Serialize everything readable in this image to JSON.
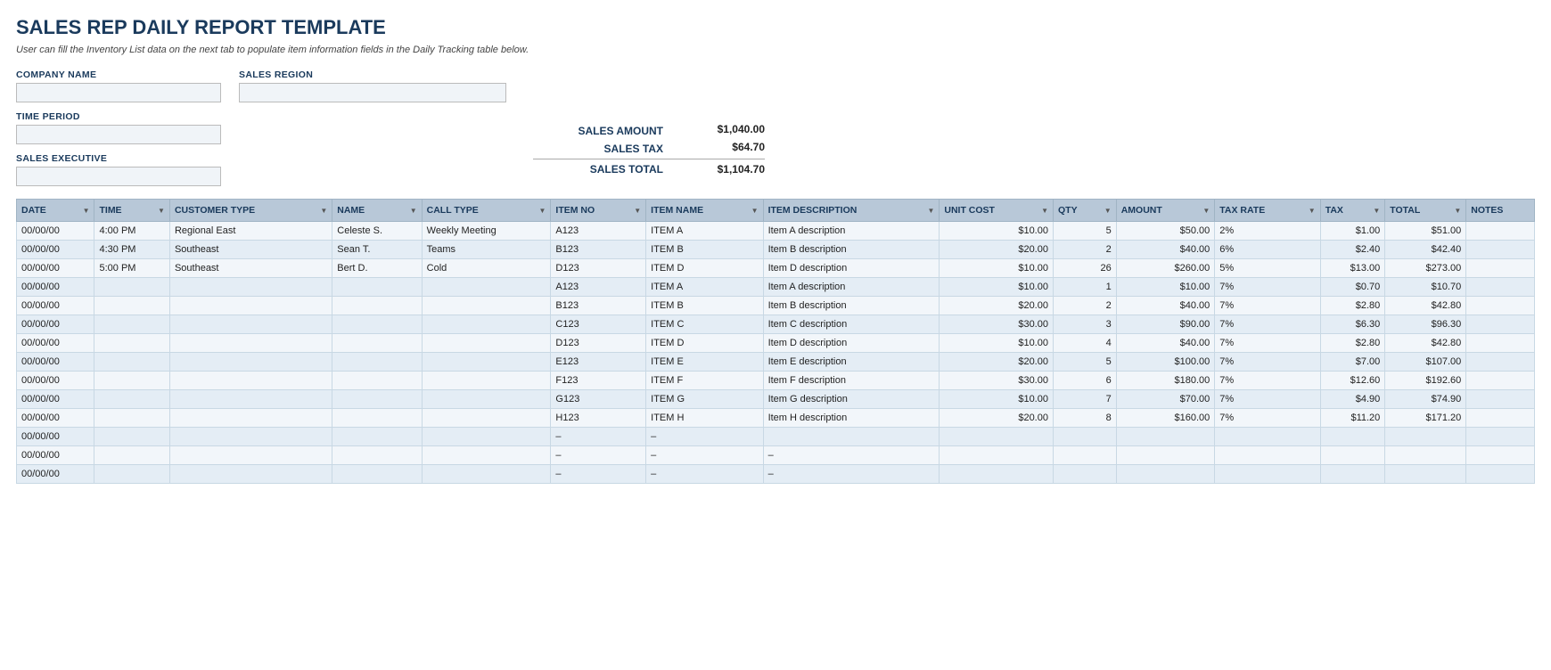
{
  "title": "SALES REP DAILY REPORT TEMPLATE",
  "subtitle": "User can fill the Inventory List data on the next tab to populate item information fields in the Daily Tracking table below.",
  "form": {
    "company_name_label": "COMPANY NAME",
    "company_name_value": "",
    "sales_region_label": "SALES REGION",
    "sales_region_value": "",
    "time_period_label": "TIME PERIOD",
    "time_period_value": "",
    "sales_executive_label": "SALES EXECUTIVE",
    "sales_executive_value": ""
  },
  "summary": {
    "sales_amount_label": "SALES AMOUNT",
    "sales_amount_value": "$1,040.00",
    "sales_tax_label": "SALES TAX",
    "sales_tax_value": "$64.70",
    "sales_total_label": "SALES TOTAL",
    "sales_total_value": "$1,104.70"
  },
  "table": {
    "columns": [
      {
        "id": "date",
        "label": "DATE"
      },
      {
        "id": "time",
        "label": "TIME"
      },
      {
        "id": "customer_type",
        "label": "CUSTOMER TYPE"
      },
      {
        "id": "name",
        "label": "NAME"
      },
      {
        "id": "call_type",
        "label": "CALL TYPE"
      },
      {
        "id": "item_no",
        "label": "ITEM NO"
      },
      {
        "id": "item_name",
        "label": "ITEM NAME"
      },
      {
        "id": "item_description",
        "label": "ITEM DESCRIPTION"
      },
      {
        "id": "unit_cost",
        "label": "UNIT COST"
      },
      {
        "id": "qty",
        "label": "QTY"
      },
      {
        "id": "amount",
        "label": "AMOUNT"
      },
      {
        "id": "tax_rate",
        "label": "TAX RATE"
      },
      {
        "id": "tax",
        "label": "TAX"
      },
      {
        "id": "total",
        "label": "TOTAL"
      },
      {
        "id": "notes",
        "label": "NOTES"
      }
    ],
    "rows": [
      {
        "date": "00/00/00",
        "time": "4:00 PM",
        "customer_type": "Regional East",
        "name": "Celeste S.",
        "call_type": "Weekly Meeting",
        "item_no": "A123",
        "item_name": "ITEM A",
        "item_description": "Item A description",
        "unit_cost": "$10.00",
        "qty": "5",
        "amount": "$50.00",
        "tax_rate": "2%",
        "tax": "$1.00",
        "total": "$51.00",
        "notes": ""
      },
      {
        "date": "00/00/00",
        "time": "4:30 PM",
        "customer_type": "Southeast",
        "name": "Sean T.",
        "call_type": "Teams",
        "item_no": "B123",
        "item_name": "ITEM B",
        "item_description": "Item B description",
        "unit_cost": "$20.00",
        "qty": "2",
        "amount": "$40.00",
        "tax_rate": "6%",
        "tax": "$2.40",
        "total": "$42.40",
        "notes": ""
      },
      {
        "date": "00/00/00",
        "time": "5:00 PM",
        "customer_type": "Southeast",
        "name": "Bert D.",
        "call_type": "Cold",
        "item_no": "D123",
        "item_name": "ITEM D",
        "item_description": "Item D description",
        "unit_cost": "$10.00",
        "qty": "26",
        "amount": "$260.00",
        "tax_rate": "5%",
        "tax": "$13.00",
        "total": "$273.00",
        "notes": ""
      },
      {
        "date": "00/00/00",
        "time": "",
        "customer_type": "",
        "name": "",
        "call_type": "",
        "item_no": "A123",
        "item_name": "ITEM A",
        "item_description": "Item A description",
        "unit_cost": "$10.00",
        "qty": "1",
        "amount": "$10.00",
        "tax_rate": "7%",
        "tax": "$0.70",
        "total": "$10.70",
        "notes": ""
      },
      {
        "date": "00/00/00",
        "time": "",
        "customer_type": "",
        "name": "",
        "call_type": "",
        "item_no": "B123",
        "item_name": "ITEM B",
        "item_description": "Item B description",
        "unit_cost": "$20.00",
        "qty": "2",
        "amount": "$40.00",
        "tax_rate": "7%",
        "tax": "$2.80",
        "total": "$42.80",
        "notes": ""
      },
      {
        "date": "00/00/00",
        "time": "",
        "customer_type": "",
        "name": "",
        "call_type": "",
        "item_no": "C123",
        "item_name": "ITEM C",
        "item_description": "Item C description",
        "unit_cost": "$30.00",
        "qty": "3",
        "amount": "$90.00",
        "tax_rate": "7%",
        "tax": "$6.30",
        "total": "$96.30",
        "notes": ""
      },
      {
        "date": "00/00/00",
        "time": "",
        "customer_type": "",
        "name": "",
        "call_type": "",
        "item_no": "D123",
        "item_name": "ITEM D",
        "item_description": "Item D description",
        "unit_cost": "$10.00",
        "qty": "4",
        "amount": "$40.00",
        "tax_rate": "7%",
        "tax": "$2.80",
        "total": "$42.80",
        "notes": ""
      },
      {
        "date": "00/00/00",
        "time": "",
        "customer_type": "",
        "name": "",
        "call_type": "",
        "item_no": "E123",
        "item_name": "ITEM E",
        "item_description": "Item E description",
        "unit_cost": "$20.00",
        "qty": "5",
        "amount": "$100.00",
        "tax_rate": "7%",
        "tax": "$7.00",
        "total": "$107.00",
        "notes": ""
      },
      {
        "date": "00/00/00",
        "time": "",
        "customer_type": "",
        "name": "",
        "call_type": "",
        "item_no": "F123",
        "item_name": "ITEM F",
        "item_description": "Item F description",
        "unit_cost": "$30.00",
        "qty": "6",
        "amount": "$180.00",
        "tax_rate": "7%",
        "tax": "$12.60",
        "total": "$192.60",
        "notes": ""
      },
      {
        "date": "00/00/00",
        "time": "",
        "customer_type": "",
        "name": "",
        "call_type": "",
        "item_no": "G123",
        "item_name": "ITEM G",
        "item_description": "Item G description",
        "unit_cost": "$10.00",
        "qty": "7",
        "amount": "$70.00",
        "tax_rate": "7%",
        "tax": "$4.90",
        "total": "$74.90",
        "notes": ""
      },
      {
        "date": "00/00/00",
        "time": "",
        "customer_type": "",
        "name": "",
        "call_type": "",
        "item_no": "H123",
        "item_name": "ITEM H",
        "item_description": "Item H description",
        "unit_cost": "$20.00",
        "qty": "8",
        "amount": "$160.00",
        "tax_rate": "7%",
        "tax": "$11.20",
        "total": "$171.20",
        "notes": ""
      },
      {
        "date": "00/00/00",
        "time": "",
        "customer_type": "",
        "name": "",
        "call_type": "",
        "item_no": "–",
        "item_name": "–",
        "item_description": "",
        "unit_cost": "",
        "qty": "",
        "amount": "",
        "tax_rate": "",
        "tax": "",
        "total": "",
        "notes": ""
      },
      {
        "date": "00/00/00",
        "time": "",
        "customer_type": "",
        "name": "",
        "call_type": "",
        "item_no": "–",
        "item_name": "–",
        "item_description": "–",
        "unit_cost": "",
        "qty": "",
        "amount": "",
        "tax_rate": "",
        "tax": "",
        "total": "",
        "notes": ""
      },
      {
        "date": "00/00/00",
        "time": "",
        "customer_type": "",
        "name": "",
        "call_type": "",
        "item_no": "–",
        "item_name": "–",
        "item_description": "–",
        "unit_cost": "",
        "qty": "",
        "amount": "",
        "tax_rate": "",
        "tax": "",
        "total": "",
        "notes": ""
      }
    ]
  }
}
